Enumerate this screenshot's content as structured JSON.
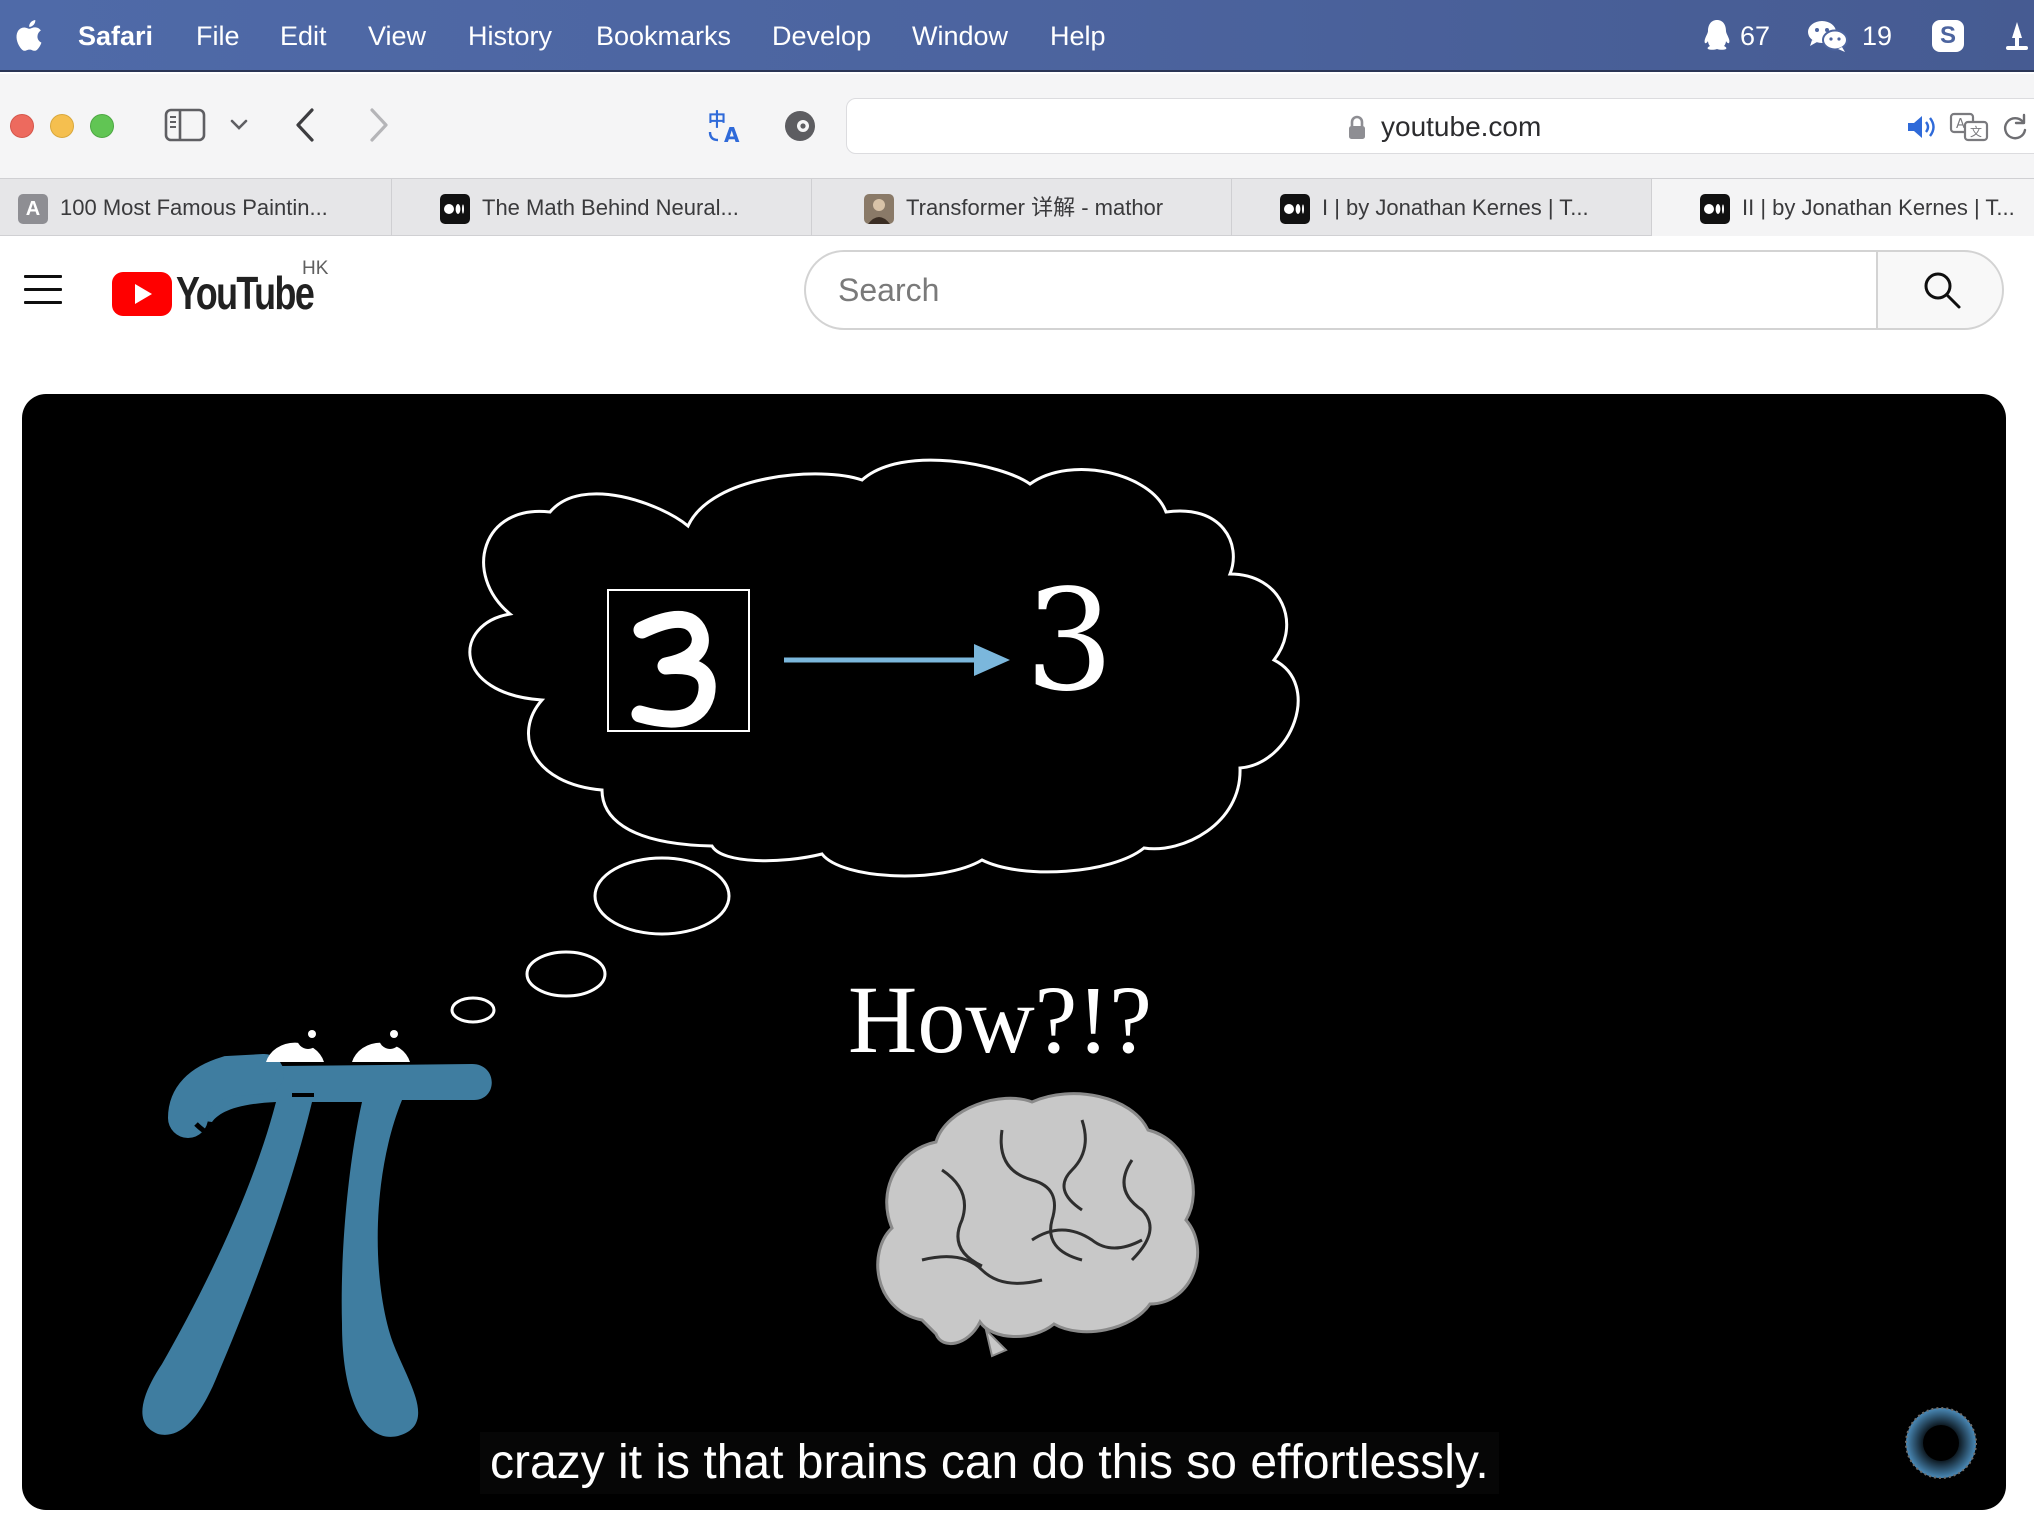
{
  "menubar": {
    "app_name": "Safari",
    "items": [
      "File",
      "Edit",
      "View",
      "History",
      "Bookmarks",
      "Develop",
      "Window",
      "Help"
    ],
    "qq_count": "67",
    "wechat_count": "19",
    "s_badge": "S"
  },
  "toolbar": {
    "url": "youtube.com"
  },
  "tabs": [
    {
      "title": "100 Most Famous Paintin...",
      "favicon_letter": "A",
      "favicon": "letter-a-icon"
    },
    {
      "title": "The Math Behind Neural...",
      "favicon": "medium-icon"
    },
    {
      "title": "Transformer 详解 - mathor",
      "favicon": "portrait-icon"
    },
    {
      "title": "I | by Jonathan Kernes | T...",
      "favicon": "medium-icon"
    },
    {
      "title": "II | by Jonathan Kernes | T...",
      "favicon": "medium-icon"
    }
  ],
  "youtube": {
    "logo_text": "YouTube",
    "region": "HK",
    "search_placeholder": "Search"
  },
  "video": {
    "digit_label": "3",
    "question": "How?!?",
    "caption": "crazy it is that brains can do this so effortlessly."
  },
  "colors": {
    "menubar": "#4c649f",
    "youtube_red": "#ff0000",
    "pi_blue": "#3f7da0",
    "arrow_blue": "#7bb7dc",
    "brain_gray": "#c8c8c8"
  }
}
